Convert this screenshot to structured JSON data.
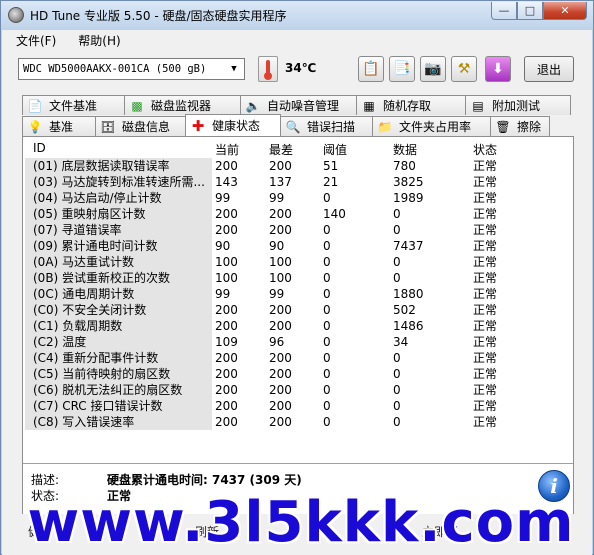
{
  "window": {
    "title": "HD Tune 专业版 5.50 - 硬盘/固态硬盘实用程序"
  },
  "menu": {
    "items": [
      "文件(F)",
      "帮助(H)"
    ]
  },
  "toolbar": {
    "drive": "WDC WD5000AAKX-001CA (500 gB)",
    "temperature": "34℃",
    "exit_label": "退出"
  },
  "tabs_top": [
    "文件基准",
    "磁盘监视器",
    "自动噪音管理",
    "随机存取",
    "附加测试"
  ],
  "tabs_bottom": [
    "基准",
    "磁盘信息",
    "健康状态",
    "错误扫描",
    "文件夹占用率",
    "擦除"
  ],
  "smart": {
    "headers": [
      "ID",
      "当前",
      "最差",
      "阈值",
      "数据",
      "状态"
    ],
    "rows": [
      {
        "id": "(01) 底层数据读取错误率",
        "cur": "200",
        "worst": "200",
        "thr": "51",
        "data": "780",
        "status": "正常"
      },
      {
        "id": "(03) 马达旋转到标准转速所需...",
        "cur": "143",
        "worst": "137",
        "thr": "21",
        "data": "3825",
        "status": "正常"
      },
      {
        "id": "(04) 马达启动/停止计数",
        "cur": "99",
        "worst": "99",
        "thr": "0",
        "data": "1989",
        "status": "正常"
      },
      {
        "id": "(05) 重映射扇区计数",
        "cur": "200",
        "worst": "200",
        "thr": "140",
        "data": "0",
        "status": "正常"
      },
      {
        "id": "(07) 寻道错误率",
        "cur": "200",
        "worst": "200",
        "thr": "0",
        "data": "0",
        "status": "正常"
      },
      {
        "id": "(09) 累计通电时间计数",
        "cur": "90",
        "worst": "90",
        "thr": "0",
        "data": "7437",
        "status": "正常"
      },
      {
        "id": "(0A) 马达重试计数",
        "cur": "100",
        "worst": "100",
        "thr": "0",
        "data": "0",
        "status": "正常"
      },
      {
        "id": "(0B) 尝试重新校正的次数",
        "cur": "100",
        "worst": "100",
        "thr": "0",
        "data": "0",
        "status": "正常"
      },
      {
        "id": "(0C) 通电周期计数",
        "cur": "99",
        "worst": "99",
        "thr": "0",
        "data": "1880",
        "status": "正常"
      },
      {
        "id": "(C0) 不安全关闭计数",
        "cur": "200",
        "worst": "200",
        "thr": "0",
        "data": "502",
        "status": "正常"
      },
      {
        "id": "(C1) 负载周期数",
        "cur": "200",
        "worst": "200",
        "thr": "0",
        "data": "1486",
        "status": "正常"
      },
      {
        "id": "(C2) 温度",
        "cur": "109",
        "worst": "96",
        "thr": "0",
        "data": "34",
        "status": "正常"
      },
      {
        "id": "(C4) 重新分配事件计数",
        "cur": "200",
        "worst": "200",
        "thr": "0",
        "data": "0",
        "status": "正常"
      },
      {
        "id": "(C5) 当前待映射的扇区数",
        "cur": "200",
        "worst": "200",
        "thr": "0",
        "data": "0",
        "status": "正常"
      },
      {
        "id": "(C6) 脱机无法纠正的扇区数",
        "cur": "200",
        "worst": "200",
        "thr": "0",
        "data": "0",
        "status": "正常"
      },
      {
        "id": "(C7) CRC 接口错误计数",
        "cur": "200",
        "worst": "200",
        "thr": "0",
        "data": "0",
        "status": "正常"
      },
      {
        "id": "(C8) 写入错误速率",
        "cur": "200",
        "worst": "200",
        "thr": "0",
        "data": "0",
        "status": "正常"
      }
    ]
  },
  "details": {
    "desc_label": "描述:",
    "desc_value": "硬盘累计通电时间: 7437 (309 天)",
    "status_label": "状态:",
    "status_value": "正常"
  },
  "bottom": {
    "left_fragment": "健",
    "mid_fragment": "刷新",
    "right_fragment": "立即刷"
  },
  "watermark": "www.3l5kkk.com"
}
